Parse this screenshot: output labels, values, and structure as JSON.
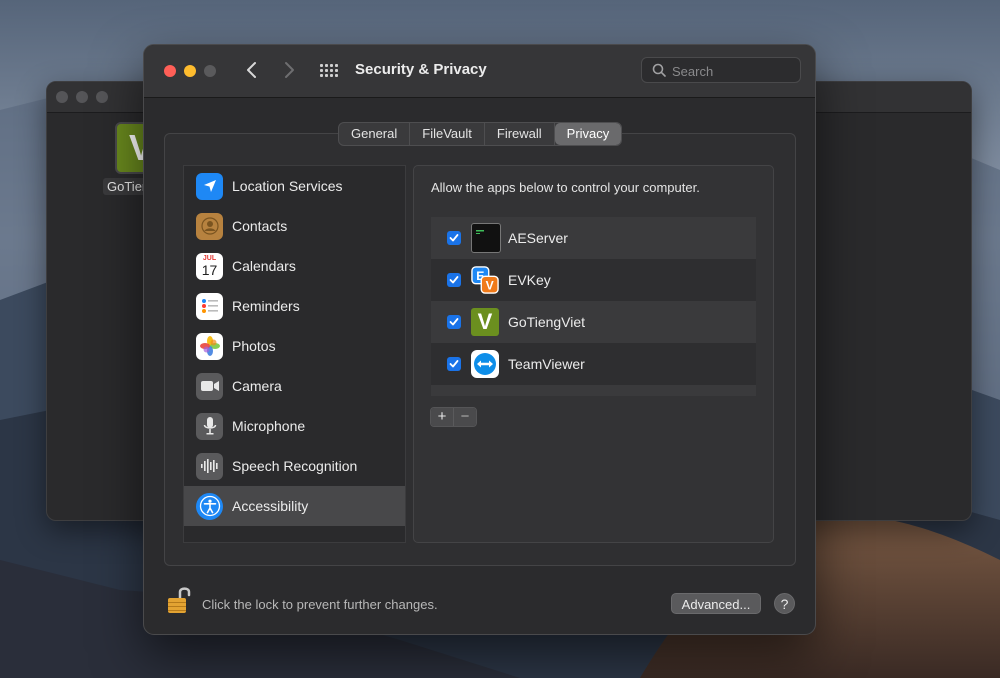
{
  "background_window": {
    "app_label": "GoTieng",
    "app_icon_letter": "V"
  },
  "window": {
    "title": "Security & Privacy",
    "search_placeholder": "Search",
    "tabs": [
      {
        "label": "General",
        "active": false
      },
      {
        "label": "FileVault",
        "active": false
      },
      {
        "label": "Firewall",
        "active": false
      },
      {
        "label": "Privacy",
        "active": true
      }
    ],
    "sidebar": {
      "items": [
        {
          "label": "Location Services",
          "icon": "location-arrow-icon",
          "active": false
        },
        {
          "label": "Contacts",
          "icon": "contacts-icon",
          "active": false
        },
        {
          "label": "Calendars",
          "icon": "calendar-icon",
          "active": false,
          "icon_month": "JUL",
          "icon_day": "17"
        },
        {
          "label": "Reminders",
          "icon": "reminders-icon",
          "active": false
        },
        {
          "label": "Photos",
          "icon": "photos-icon",
          "active": false
        },
        {
          "label": "Camera",
          "icon": "camera-icon",
          "active": false
        },
        {
          "label": "Microphone",
          "icon": "microphone-icon",
          "active": false
        },
        {
          "label": "Speech Recognition",
          "icon": "waveform-icon",
          "active": false
        },
        {
          "label": "Accessibility",
          "icon": "accessibility-icon",
          "active": true
        }
      ]
    },
    "panel": {
      "description": "Allow the apps below to control your computer.",
      "apps": [
        {
          "name": "AEServer",
          "checked": true,
          "icon": "terminal-icon"
        },
        {
          "name": "EVKey",
          "checked": true,
          "icon": "evkey-icon"
        },
        {
          "name": "GoTiengViet",
          "checked": true,
          "icon": "gotiengviet-icon",
          "icon_letter": "V"
        },
        {
          "name": "TeamViewer",
          "checked": true,
          "icon": "teamviewer-icon"
        }
      ],
      "add_label": "+",
      "remove_label": "−"
    },
    "footer": {
      "lock_text": "Click the lock to prevent further changes.",
      "advanced_label": "Advanced...",
      "help_label": "?"
    }
  },
  "colors": {
    "checkbox": "#1a73e8",
    "close": "#ff5f57",
    "minimize": "#febc2e",
    "location": "#1e88f5",
    "accessibility": "#1e88f5"
  }
}
